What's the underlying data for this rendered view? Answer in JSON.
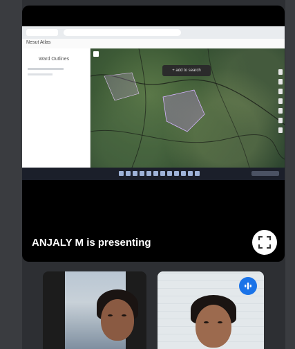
{
  "shared_screen": {
    "app_title": "Nesut Atlas",
    "panel_heading": "Ward Outlines",
    "map_tooltip": "+ add to search"
  },
  "presenter": {
    "label": "ANJALY M is presenting"
  },
  "controls": {
    "fullscreen_icon": "fullscreen-icon",
    "audio_icon": "audio-levels-icon"
  },
  "colors": {
    "tile_background": "#000000",
    "page_background": "#2d2f33",
    "audio_badge": "#1a73e8"
  }
}
